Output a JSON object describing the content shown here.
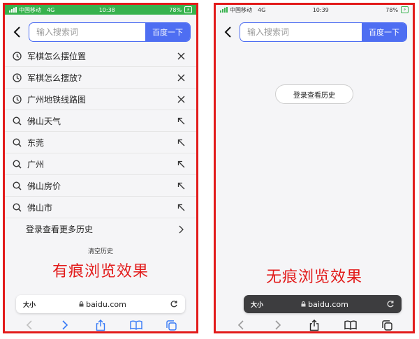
{
  "colors": {
    "accent": "#4e6ef2",
    "highlight_border": "#e21b1b",
    "status_green": "#37b24d"
  },
  "left": {
    "status": {
      "carrier": "中国移动",
      "network": "4G",
      "time": "10:38",
      "battery": "78%"
    },
    "search": {
      "placeholder": "输入搜索词",
      "button": "百度一下"
    },
    "items": [
      {
        "icon": "clock-icon",
        "label": "军棋怎么摆位置",
        "action": "close-icon"
      },
      {
        "icon": "clock-icon",
        "label": "军棋怎么摆放?",
        "action": "close-icon"
      },
      {
        "icon": "clock-icon",
        "label": "广州地铁线路图",
        "action": "close-icon"
      },
      {
        "icon": "search-icon",
        "label": "佛山天气",
        "action": "arrow-up-left-icon"
      },
      {
        "icon": "search-icon",
        "label": "东莞",
        "action": "arrow-up-left-icon"
      },
      {
        "icon": "search-icon",
        "label": "广州",
        "action": "arrow-up-left-icon"
      },
      {
        "icon": "search-icon",
        "label": "佛山房价",
        "action": "arrow-up-left-icon"
      },
      {
        "icon": "search-icon",
        "label": "佛山市",
        "action": "arrow-up-left-icon"
      }
    ],
    "more_history": "登录查看更多历史",
    "clear_history": "清空历史",
    "caption": "有痕浏览效果",
    "urlbar": {
      "size_label": "大小",
      "url": "baidu.com"
    }
  },
  "right": {
    "status": {
      "carrier": "中国移动",
      "network": "4G",
      "time": "10:39",
      "battery": "78%"
    },
    "search": {
      "placeholder": "输入搜索词",
      "button": "百度一下"
    },
    "login_history": "登录查看历史",
    "caption": "无痕浏览效果",
    "urlbar": {
      "size_label": "大小",
      "url": "baidu.com"
    }
  }
}
